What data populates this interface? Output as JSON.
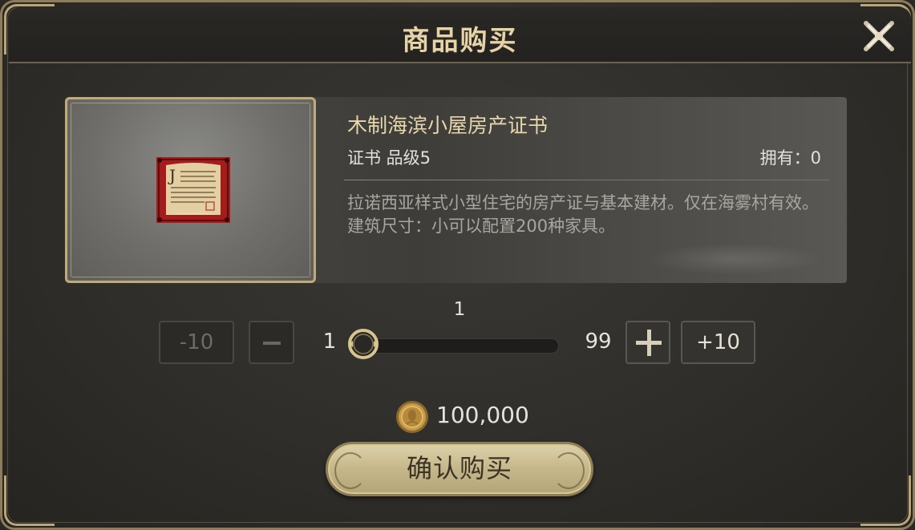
{
  "dialog": {
    "title": "商品购买"
  },
  "item": {
    "name": "木制海滨小屋房产证书",
    "type_grade": "证书 品级5",
    "owned": "拥有：0",
    "description": "拉诺西亚样式小型住宅的房产证与基本建材。仅在海雾村有效。建筑尺寸：小可以配置200种家具。",
    "icon": "property-certificate-icon"
  },
  "quantity": {
    "current": "1",
    "min": "1",
    "max": "99",
    "value": 1,
    "minus10_label": "-10",
    "plus10_label": "+10"
  },
  "price": {
    "amount": "100,000",
    "currency_icon": "gil-coin-icon"
  },
  "confirm": {
    "label": "确认购买"
  },
  "colors": {
    "accent_gold": "#c5b789",
    "title_gold": "#e6d3a6",
    "item_name": "#e8d7ad",
    "panel_bg": "#302e2a"
  }
}
